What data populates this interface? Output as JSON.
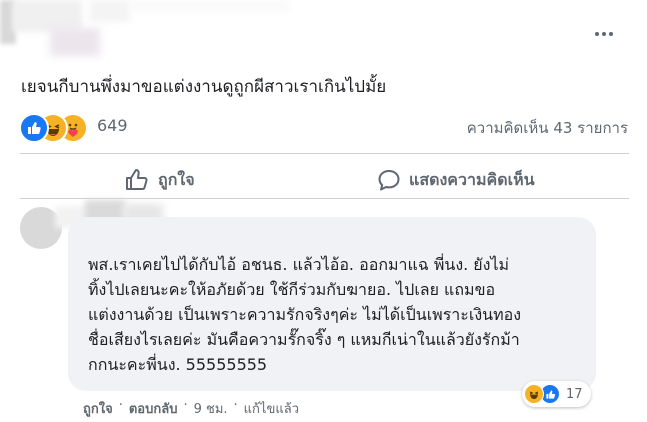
{
  "post": {
    "text": "เยจนกีบานพึ่งมาขอแต่งงานดูถูกผีสาวเราเกินไปมั้ย",
    "reaction_count": "649",
    "comment_count": "ความคิดเห็น 43 รายการ"
  },
  "actions": {
    "like_label": "ถูกใจ",
    "comment_label": "แสดงความคิดเห็น"
  },
  "comment": {
    "lines": [
      "พส.เราเคยไปได้กับไอ้ อชนธ. แล้วไอ้อ. ออกมาแฉ พี่นง. ยังไม่",
      "ทิ้งไปเลยนะคะให้อภัยด้วย ใช้กีร่วมกับฆายอ. ไปเลย แถมขอ",
      "แต่งงานด้วย เป็นเพราะความรักจริงๆค่ะ ไม่ได้เป็นเพราะเงินทอง",
      "ชื่อเสียงไรเลยค่ะ มันคือความรั๊กจริ๊ง ๆ แหมกีเน่าในแล้วยังรักม้า",
      "กกนะคะพี่นง. 55555555"
    ],
    "reaction_count": "17",
    "like_label": "ถูกใจ",
    "reply_label": "ตอบกลับ",
    "time": "9 ชม.",
    "edited_label": "แก้ไขแล้ว",
    "separator": "·"
  },
  "colors": {
    "like_blue": "#1877f2",
    "haha_yellow": "#f7b125",
    "secondary_text": "#606770",
    "bubble_bg": "#f0f2f5"
  },
  "icons": [
    "more-options-icon",
    "like-reaction-icon",
    "haha-reaction-icon",
    "care-reaction-icon",
    "thumbs-up-icon",
    "comment-bubble-icon"
  ]
}
